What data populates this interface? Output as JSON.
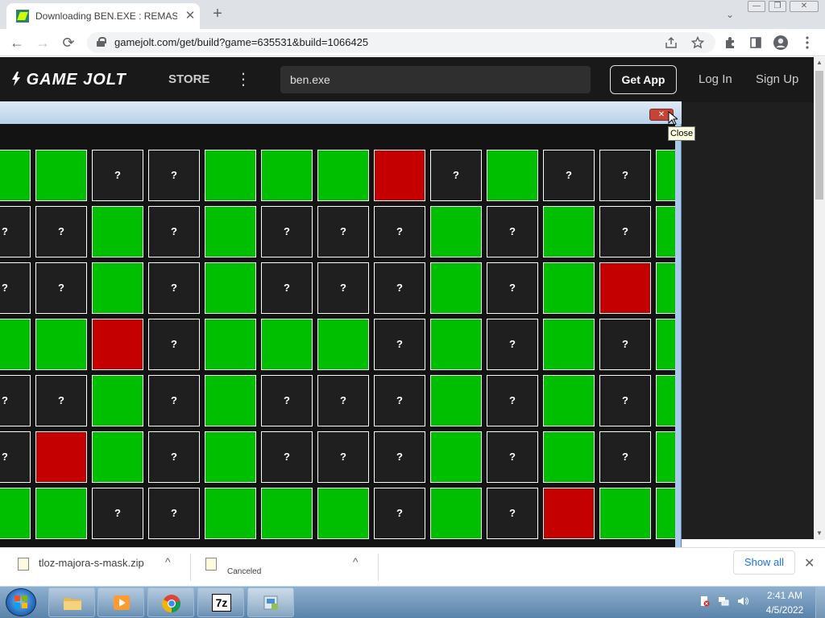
{
  "browser": {
    "tab_title": "Downloading BEN.EXE : REMAST",
    "tab_close": "✕",
    "new_tab": "+",
    "tabs_dropdown": "⌄",
    "window_buttons": [
      "—",
      "❐",
      "✕"
    ],
    "url": "gamejolt.com/get/build?game=635531&build=1066425",
    "nav": {
      "back": "←",
      "forward": "→",
      "reload": "⟳"
    },
    "tools": [
      "share-icon",
      "star-icon",
      "extensions-icon",
      "sidepanel-icon",
      "profile-icon",
      "menu-icon"
    ]
  },
  "site": {
    "logo": "GAME JOLT",
    "store": "STORE",
    "more": "⋮",
    "search_value": "ben.exe",
    "get_app": "Get App",
    "log_in": "Log In",
    "sign_up": "Sign Up"
  },
  "game": {
    "close_glyph": "✕",
    "tooltip": "Close",
    "hidden_symbol": "?",
    "rows": [
      [
        "green",
        "green",
        "hidden",
        "hidden",
        "green",
        "green",
        "green",
        "red",
        "hidden",
        "green",
        "hidden",
        "hidden",
        "green"
      ],
      [
        "hidden",
        "hidden",
        "green",
        "hidden",
        "green",
        "hidden",
        "hidden",
        "hidden",
        "green",
        "hidden",
        "green",
        "hidden",
        "green"
      ],
      [
        "hidden",
        "hidden",
        "green",
        "hidden",
        "green",
        "hidden",
        "hidden",
        "hidden",
        "green",
        "hidden",
        "green",
        "red",
        "green"
      ],
      [
        "green",
        "green",
        "red",
        "hidden",
        "green",
        "green",
        "green",
        "hidden",
        "green",
        "hidden",
        "green",
        "hidden",
        "green"
      ],
      [
        "hidden",
        "hidden",
        "green",
        "hidden",
        "green",
        "hidden",
        "hidden",
        "hidden",
        "green",
        "hidden",
        "green",
        "hidden",
        "green"
      ],
      [
        "hidden",
        "red",
        "green",
        "hidden",
        "green",
        "hidden",
        "hidden",
        "hidden",
        "green",
        "hidden",
        "green",
        "hidden",
        "green"
      ],
      [
        "green",
        "green",
        "hidden",
        "hidden",
        "green",
        "green",
        "green",
        "hidden",
        "green",
        "hidden",
        "red",
        "green",
        "green"
      ]
    ],
    "colors": {
      "green": "#00bf00",
      "red": "#c40000",
      "hidden": "#1f1f1f"
    }
  },
  "downloads": {
    "item1_name": "tloz-majora-s-mask.zip",
    "item2_status": "Canceled",
    "chevron": "^",
    "show_all": "Show all",
    "close": "✕"
  },
  "taskbar": {
    "apps": [
      "explorer-icon",
      "media-player-icon",
      "chrome-icon",
      "7zip-icon",
      "game-icon"
    ],
    "seven_zip_label": "7z",
    "time": "2:41 AM",
    "date": "4/5/2022"
  }
}
